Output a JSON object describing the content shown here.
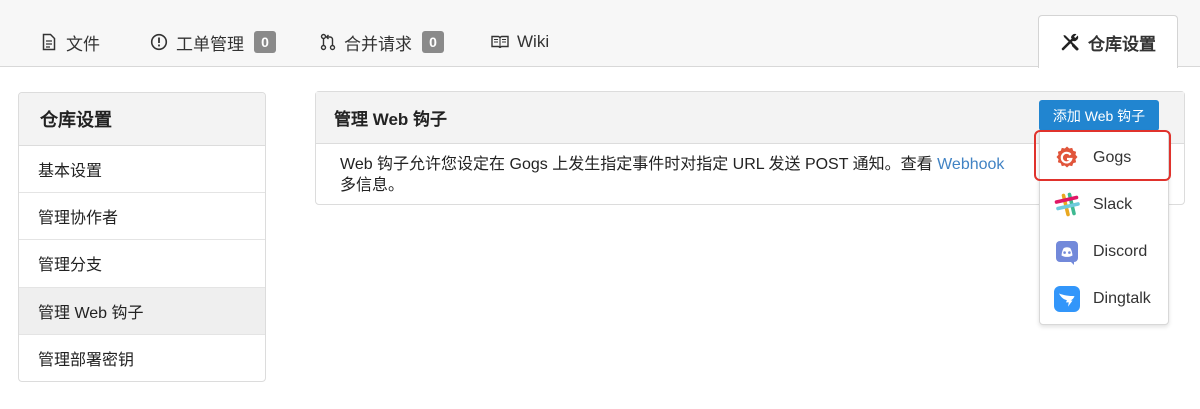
{
  "tabs": [
    {
      "label": "文件",
      "icon": "file-icon"
    },
    {
      "label": "工单管理",
      "count": "0",
      "icon": "issue-icon"
    },
    {
      "label": "合并请求",
      "count": "0",
      "icon": "pull-request-icon"
    },
    {
      "label": "Wiki",
      "icon": "book-icon"
    },
    {
      "label": "仓库设置",
      "icon": "tools-icon"
    }
  ],
  "menu": {
    "title": "仓库设置",
    "items": [
      "基本设置",
      "管理协作者",
      "管理分支",
      "管理 Web 钩子",
      "管理部署密钥"
    ],
    "active_index": 3
  },
  "panel": {
    "title": "管理 Web 钩子",
    "add_button": "添加 Web 钩子",
    "description": "Web 钩子允许您设定在 Gogs 上发生指定事件时对指定 URL 发送 POST 通知。查看 ",
    "link_text": "Webhook",
    "description_end": "多信息。"
  },
  "dropdown": {
    "items": [
      {
        "label": "Gogs",
        "icon": "gogs-icon"
      },
      {
        "label": "Slack",
        "icon": "slack-icon"
      },
      {
        "label": "Discord",
        "icon": "discord-icon"
      },
      {
        "label": "Dingtalk",
        "icon": "dingtalk-icon"
      }
    ],
    "highlighted_index": 0
  },
  "colors": {
    "accent": "#2185d0",
    "link": "#4183c4",
    "highlight": "#e0322c",
    "gogs": "#e1553b",
    "discord": "#7289da",
    "dingtalk": "#3296fa"
  }
}
